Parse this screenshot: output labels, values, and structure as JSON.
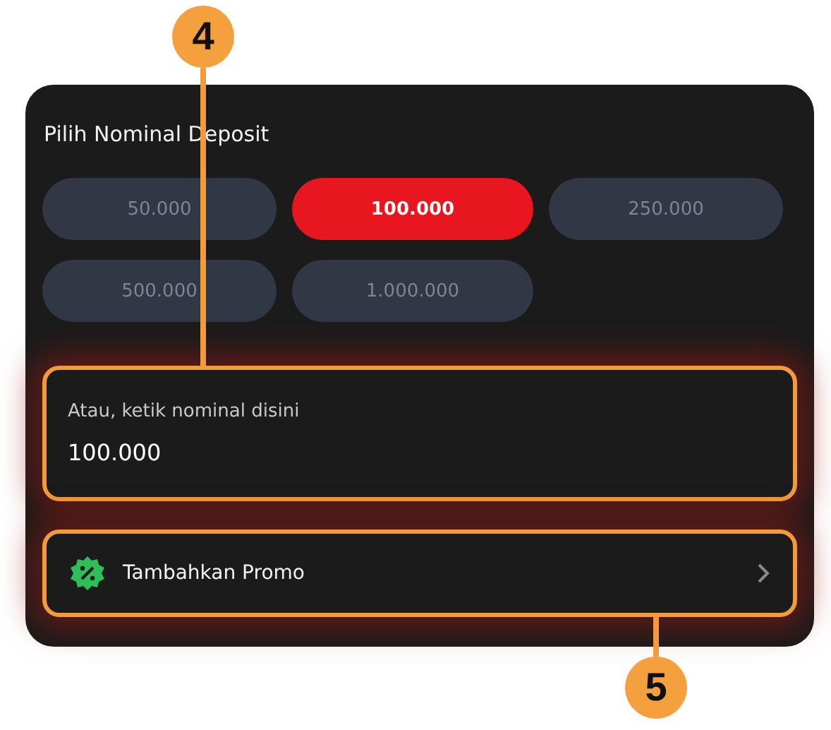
{
  "title": "Pilih Nominal Deposit",
  "amounts": [
    {
      "label": "50.000",
      "selected": false
    },
    {
      "label": "100.000",
      "selected": true
    },
    {
      "label": "250.000",
      "selected": false
    },
    {
      "label": "500.000",
      "selected": false
    },
    {
      "label": "1.000.000",
      "selected": false
    }
  ],
  "amount_field": {
    "label": "Atau, ketik nominal disini",
    "value": "100.000",
    "callout": "4"
  },
  "promo_button": {
    "label": "Tambahkan Promo",
    "callout": "5"
  }
}
